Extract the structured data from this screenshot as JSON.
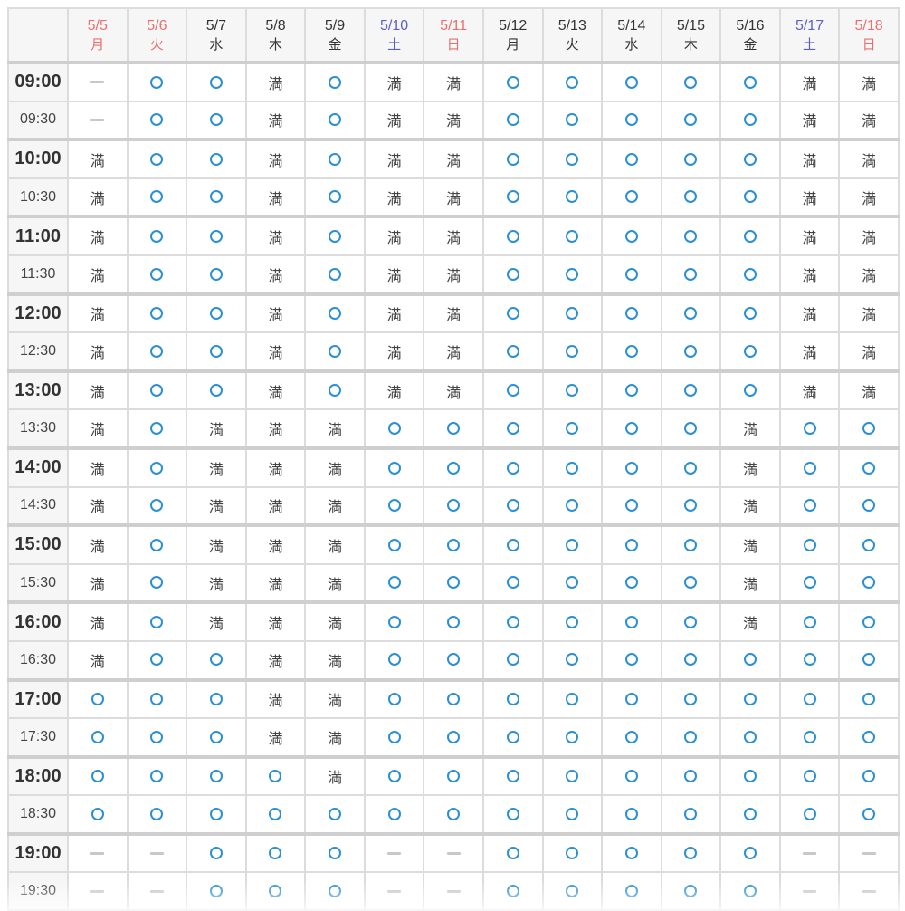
{
  "legend": {
    "available_mark": "available-circle",
    "full_mark": "満",
    "closed_mark": "closed-dash"
  },
  "colors": {
    "available": "#2b8fd6",
    "holiday": "#e8706f",
    "saturday": "#5b5fc9",
    "weekday": "#333333",
    "header_bg": "#f6f6f6"
  },
  "days": [
    {
      "date": "5/5",
      "weekday": "月",
      "type": "hol"
    },
    {
      "date": "5/6",
      "weekday": "火",
      "type": "hol"
    },
    {
      "date": "5/7",
      "weekday": "水",
      "type": "wk"
    },
    {
      "date": "5/8",
      "weekday": "木",
      "type": "wk"
    },
    {
      "date": "5/9",
      "weekday": "金",
      "type": "wk"
    },
    {
      "date": "5/10",
      "weekday": "土",
      "type": "sat"
    },
    {
      "date": "5/11",
      "weekday": "日",
      "type": "sun"
    },
    {
      "date": "5/12",
      "weekday": "月",
      "type": "wk"
    },
    {
      "date": "5/13",
      "weekday": "火",
      "type": "wk"
    },
    {
      "date": "5/14",
      "weekday": "水",
      "type": "wk"
    },
    {
      "date": "5/15",
      "weekday": "木",
      "type": "wk"
    },
    {
      "date": "5/16",
      "weekday": "金",
      "type": "wk"
    },
    {
      "date": "5/17",
      "weekday": "土",
      "type": "sat"
    },
    {
      "date": "5/18",
      "weekday": "日",
      "type": "sun"
    }
  ],
  "slots": [
    {
      "time": "09:00",
      "hour": true,
      "status": "-ooxoxxoooooxx"
    },
    {
      "time": "09:30",
      "hour": false,
      "status": "-ooxoxxoooooxx"
    },
    {
      "time": "10:00",
      "hour": true,
      "status": "xooxoxxoooooxx"
    },
    {
      "time": "10:30",
      "hour": false,
      "status": "xooxoxxoooooxx"
    },
    {
      "time": "11:00",
      "hour": true,
      "status": "xooxoxxoooooxx"
    },
    {
      "time": "11:30",
      "hour": false,
      "status": "xooxoxxoooooxx"
    },
    {
      "time": "12:00",
      "hour": true,
      "status": "xooxoxxoooooxx"
    },
    {
      "time": "12:30",
      "hour": false,
      "status": "xooxoxxoooooxx"
    },
    {
      "time": "13:00",
      "hour": true,
      "status": "xooxoxxoooooxx"
    },
    {
      "time": "13:30",
      "hour": false,
      "status": "xoxxxoooooox"
    },
    {
      "time": "14:00",
      "hour": true,
      "status": "xoxxxoooooox"
    },
    {
      "time": "14:30",
      "hour": false,
      "status": "xoxxxoooooox"
    },
    {
      "time": "15:00",
      "hour": true,
      "status": "xoxxxoooooox"
    },
    {
      "time": "15:30",
      "hour": false,
      "status": "xoxxxoooooox"
    },
    {
      "time": "16:00",
      "hour": true,
      "status": "xoxxxoooooox"
    },
    {
      "time": "16:30",
      "hour": false,
      "status": "xooxxooooooooo"
    },
    {
      "time": "17:00",
      "hour": true,
      "status": "oooxxooooooooo"
    },
    {
      "time": "17:30",
      "hour": false,
      "status": "oooxxooooooooo"
    },
    {
      "time": "18:00",
      "hour": true,
      "status": "ooooxooooooooo"
    },
    {
      "time": "18:30",
      "hour": false,
      "status": "oooooooooooooo"
    },
    {
      "time": "19:00",
      "hour": true,
      "status": "--ooo--ooooo--"
    },
    {
      "time": "19:30",
      "hour": false,
      "status": "--ooo--ooooo--"
    }
  ]
}
